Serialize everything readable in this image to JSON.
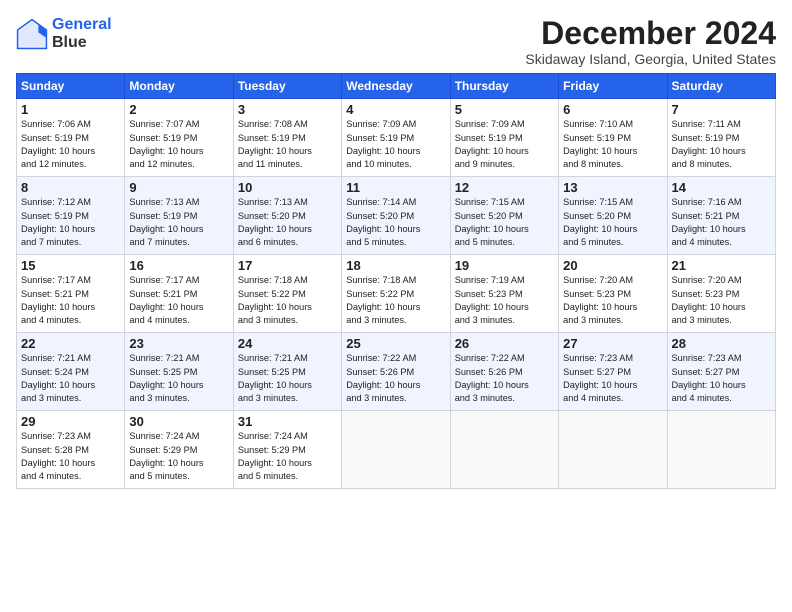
{
  "logo": {
    "line1": "General",
    "line2": "Blue"
  },
  "title": "December 2024",
  "subtitle": "Skidaway Island, Georgia, United States",
  "headers": [
    "Sunday",
    "Monday",
    "Tuesday",
    "Wednesday",
    "Thursday",
    "Friday",
    "Saturday"
  ],
  "weeks": [
    [
      {
        "day": "1",
        "info": "Sunrise: 7:06 AM\nSunset: 5:19 PM\nDaylight: 10 hours\nand 12 minutes."
      },
      {
        "day": "2",
        "info": "Sunrise: 7:07 AM\nSunset: 5:19 PM\nDaylight: 10 hours\nand 12 minutes."
      },
      {
        "day": "3",
        "info": "Sunrise: 7:08 AM\nSunset: 5:19 PM\nDaylight: 10 hours\nand 11 minutes."
      },
      {
        "day": "4",
        "info": "Sunrise: 7:09 AM\nSunset: 5:19 PM\nDaylight: 10 hours\nand 10 minutes."
      },
      {
        "day": "5",
        "info": "Sunrise: 7:09 AM\nSunset: 5:19 PM\nDaylight: 10 hours\nand 9 minutes."
      },
      {
        "day": "6",
        "info": "Sunrise: 7:10 AM\nSunset: 5:19 PM\nDaylight: 10 hours\nand 8 minutes."
      },
      {
        "day": "7",
        "info": "Sunrise: 7:11 AM\nSunset: 5:19 PM\nDaylight: 10 hours\nand 8 minutes."
      }
    ],
    [
      {
        "day": "8",
        "info": "Sunrise: 7:12 AM\nSunset: 5:19 PM\nDaylight: 10 hours\nand 7 minutes."
      },
      {
        "day": "9",
        "info": "Sunrise: 7:13 AM\nSunset: 5:19 PM\nDaylight: 10 hours\nand 7 minutes."
      },
      {
        "day": "10",
        "info": "Sunrise: 7:13 AM\nSunset: 5:20 PM\nDaylight: 10 hours\nand 6 minutes."
      },
      {
        "day": "11",
        "info": "Sunrise: 7:14 AM\nSunset: 5:20 PM\nDaylight: 10 hours\nand 5 minutes."
      },
      {
        "day": "12",
        "info": "Sunrise: 7:15 AM\nSunset: 5:20 PM\nDaylight: 10 hours\nand 5 minutes."
      },
      {
        "day": "13",
        "info": "Sunrise: 7:15 AM\nSunset: 5:20 PM\nDaylight: 10 hours\nand 5 minutes."
      },
      {
        "day": "14",
        "info": "Sunrise: 7:16 AM\nSunset: 5:21 PM\nDaylight: 10 hours\nand 4 minutes."
      }
    ],
    [
      {
        "day": "15",
        "info": "Sunrise: 7:17 AM\nSunset: 5:21 PM\nDaylight: 10 hours\nand 4 minutes."
      },
      {
        "day": "16",
        "info": "Sunrise: 7:17 AM\nSunset: 5:21 PM\nDaylight: 10 hours\nand 4 minutes."
      },
      {
        "day": "17",
        "info": "Sunrise: 7:18 AM\nSunset: 5:22 PM\nDaylight: 10 hours\nand 3 minutes."
      },
      {
        "day": "18",
        "info": "Sunrise: 7:18 AM\nSunset: 5:22 PM\nDaylight: 10 hours\nand 3 minutes."
      },
      {
        "day": "19",
        "info": "Sunrise: 7:19 AM\nSunset: 5:23 PM\nDaylight: 10 hours\nand 3 minutes."
      },
      {
        "day": "20",
        "info": "Sunrise: 7:20 AM\nSunset: 5:23 PM\nDaylight: 10 hours\nand 3 minutes."
      },
      {
        "day": "21",
        "info": "Sunrise: 7:20 AM\nSunset: 5:23 PM\nDaylight: 10 hours\nand 3 minutes."
      }
    ],
    [
      {
        "day": "22",
        "info": "Sunrise: 7:21 AM\nSunset: 5:24 PM\nDaylight: 10 hours\nand 3 minutes."
      },
      {
        "day": "23",
        "info": "Sunrise: 7:21 AM\nSunset: 5:25 PM\nDaylight: 10 hours\nand 3 minutes."
      },
      {
        "day": "24",
        "info": "Sunrise: 7:21 AM\nSunset: 5:25 PM\nDaylight: 10 hours\nand 3 minutes."
      },
      {
        "day": "25",
        "info": "Sunrise: 7:22 AM\nSunset: 5:26 PM\nDaylight: 10 hours\nand 3 minutes."
      },
      {
        "day": "26",
        "info": "Sunrise: 7:22 AM\nSunset: 5:26 PM\nDaylight: 10 hours\nand 3 minutes."
      },
      {
        "day": "27",
        "info": "Sunrise: 7:23 AM\nSunset: 5:27 PM\nDaylight: 10 hours\nand 4 minutes."
      },
      {
        "day": "28",
        "info": "Sunrise: 7:23 AM\nSunset: 5:27 PM\nDaylight: 10 hours\nand 4 minutes."
      }
    ],
    [
      {
        "day": "29",
        "info": "Sunrise: 7:23 AM\nSunset: 5:28 PM\nDaylight: 10 hours\nand 4 minutes."
      },
      {
        "day": "30",
        "info": "Sunrise: 7:24 AM\nSunset: 5:29 PM\nDaylight: 10 hours\nand 5 minutes."
      },
      {
        "day": "31",
        "info": "Sunrise: 7:24 AM\nSunset: 5:29 PM\nDaylight: 10 hours\nand 5 minutes."
      },
      {
        "day": "",
        "info": ""
      },
      {
        "day": "",
        "info": ""
      },
      {
        "day": "",
        "info": ""
      },
      {
        "day": "",
        "info": ""
      }
    ]
  ]
}
